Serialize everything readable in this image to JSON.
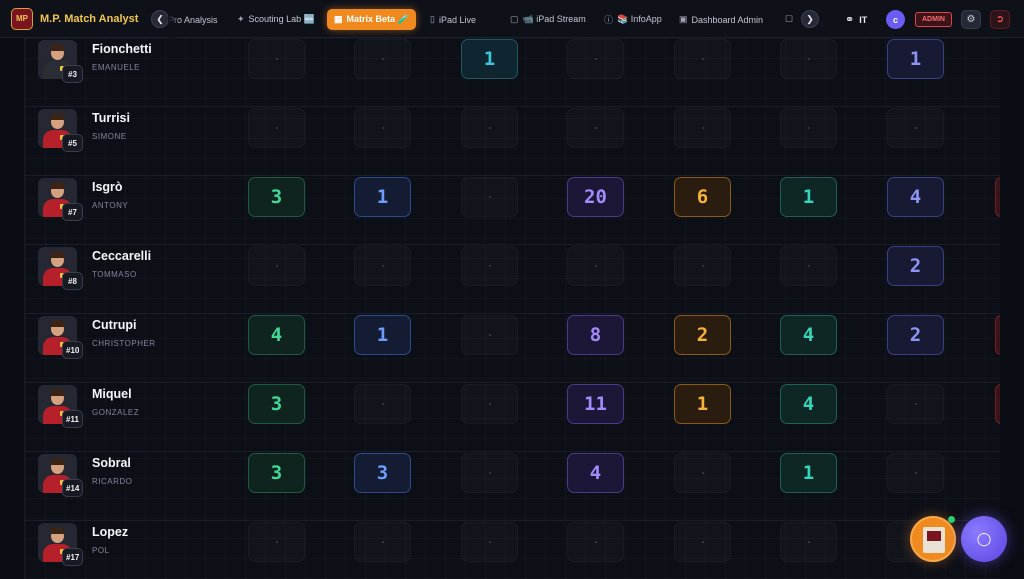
{
  "app": {
    "logo_text": "MP",
    "title": "M.P. Match Analyst"
  },
  "nav": {
    "prev_icon": "chevron-left",
    "next_icon": "chevron-right",
    "tabs": [
      {
        "label": "Pro Analysis",
        "icon": ""
      },
      {
        "label": "Scouting Lab 🆕",
        "icon": "scouting-icon"
      },
      {
        "label": "Matrix Beta 🧪",
        "icon": "grid-icon",
        "active": true
      },
      {
        "label": "iPad Live",
        "icon": "tablet-icon"
      },
      {
        "label": "📹 iPad Stream",
        "icon": "camera-icon"
      },
      {
        "label": "📚 InfoApp",
        "icon": "info-icon"
      },
      {
        "label": "Dashboard Admin",
        "icon": "briefcase-icon"
      },
      {
        "label": "",
        "icon": "chat-icon"
      }
    ],
    "language": "IT",
    "user_initial": "c",
    "role_badge": "ADMIN"
  },
  "players": [
    {
      "name": "Fionchetti",
      "surname": "EMANUELE",
      "number": "#3",
      "keeper": true,
      "cells": [
        null,
        null,
        {
          "v": "1",
          "c": 2
        },
        null,
        null,
        null,
        {
          "v": "1",
          "c": 6
        }
      ]
    },
    {
      "name": "Turrisi",
      "surname": "SIMONE",
      "number": "#5",
      "cells": [
        null,
        null,
        null,
        null,
        null,
        null,
        null
      ]
    },
    {
      "name": "Isgrò",
      "surname": "ANTONY",
      "number": "#7",
      "edge": true,
      "cells": [
        {
          "v": "3",
          "c": 0
        },
        {
          "v": "1",
          "c": 1
        },
        null,
        {
          "v": "20",
          "c": 3
        },
        {
          "v": "6",
          "c": 4
        },
        {
          "v": "1",
          "c": 5
        },
        {
          "v": "4",
          "c": 6
        }
      ]
    },
    {
      "name": "Ceccarelli",
      "surname": "TOMMASO",
      "number": "#8",
      "cells": [
        null,
        null,
        null,
        null,
        null,
        null,
        {
          "v": "2",
          "c": 6
        }
      ]
    },
    {
      "name": "Cutrupi",
      "surname": "CHRISTOPHER",
      "number": "#10",
      "edge": true,
      "cells": [
        {
          "v": "4",
          "c": 0
        },
        {
          "v": "1",
          "c": 1
        },
        null,
        {
          "v": "8",
          "c": 3
        },
        {
          "v": "2",
          "c": 4
        },
        {
          "v": "4",
          "c": 5
        },
        {
          "v": "2",
          "c": 6
        }
      ]
    },
    {
      "name": "Miquel",
      "surname": "GONZALEZ",
      "number": "#11",
      "edge": true,
      "cells": [
        {
          "v": "3",
          "c": 0
        },
        null,
        null,
        {
          "v": "11",
          "c": 3
        },
        {
          "v": "1",
          "c": 4
        },
        {
          "v": "4",
          "c": 5
        },
        null
      ]
    },
    {
      "name": "Sobral",
      "surname": "RICARDO",
      "number": "#14",
      "cells": [
        {
          "v": "3",
          "c": 0
        },
        {
          "v": "3",
          "c": 1
        },
        null,
        {
          "v": "4",
          "c": 3
        },
        null,
        {
          "v": "1",
          "c": 5
        },
        null
      ]
    },
    {
      "name": "Lopez",
      "surname": "POL",
      "number": "#17",
      "cells": [
        null,
        null,
        null,
        null,
        null,
        null,
        null
      ]
    }
  ],
  "colors": {
    "accent": "#f08a1f",
    "col0": "#3fd897",
    "col1": "#6d9dfa",
    "col2": "#3ac7de",
    "col3": "#a48bfa",
    "col4": "#f5b33a",
    "col5": "#36d4b8",
    "col6": "#8c95f5"
  }
}
